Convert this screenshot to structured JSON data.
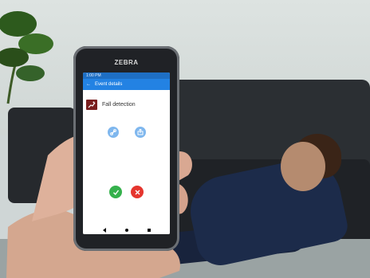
{
  "scene": {
    "caption": ""
  },
  "device": {
    "brand": "ZEBRA",
    "status_left": "1:00 PM",
    "status_right": "",
    "app_title": "Event details",
    "sub_info": "",
    "event_title": "Fall detection",
    "event_description": "",
    "colors": {
      "appbar": "#2382e3",
      "alert": "#7a1f1f",
      "accept": "#35b14c",
      "reject": "#e5352e"
    }
  }
}
